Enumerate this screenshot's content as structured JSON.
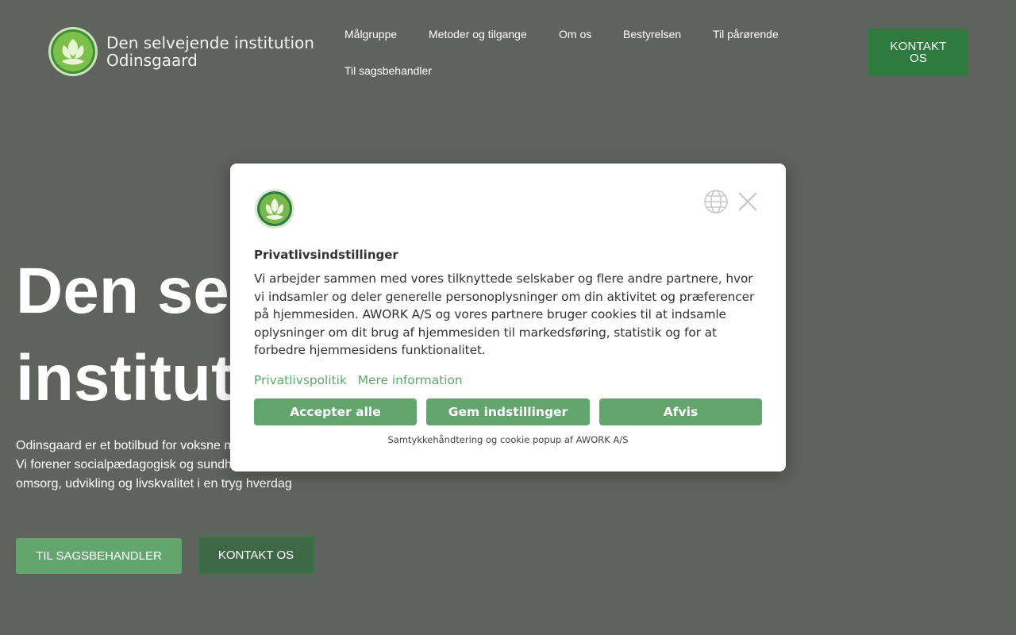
{
  "header": {
    "logo_line1": "Den selvejende institution",
    "logo_line2": "Odinsgaard",
    "nav": [
      "Målgruppe",
      "Metoder og tilgange",
      "Om os",
      "Bestyrelsen",
      "Til pårørende",
      "Til sagsbehandler"
    ],
    "cta": "KONTAKT OS"
  },
  "hero": {
    "title_line1": "Den selvejende",
    "title_line2": "institution",
    "desc_line1": "Odinsgaard er et botilbud for voksne med",
    "desc_line2": "Vi forener socialpædagogisk og sundhedsfaglig",
    "desc_line3": "omsorg, udvikling og livskvalitet i en tryg hverdag",
    "btn_primary": "TIL SAGSBEHANDLER",
    "btn_secondary": "KONTAKT OS"
  },
  "cookie": {
    "title": "Privatlivsindstillinger",
    "body": "Vi arbejder sammen med vores tilknyttede selskaber og flere andre partnere, hvor vi indsamler og deler generelle personoplysninger om din aktivitet og præferencer på hjemmesiden. AWORK A/S og vores partnere bruger cookies til at indsamle oplysninger om dit brug af hjemmesiden til markedsføring, statistik og for at forbedre hjemmesidens funktionalitet.",
    "link_privacy": "Privatlivspolitik",
    "link_more": "Mere information",
    "btn_accept": "Accepter alle",
    "btn_save": "Gem indstillinger",
    "btn_reject": "Afvis",
    "footer": "Samtykkehåndtering og cookie popup af AWORK A/S"
  },
  "colors": {
    "overlay": "#60625e",
    "accent": "#62a66d",
    "brand_dark": "#2f7a3e"
  }
}
